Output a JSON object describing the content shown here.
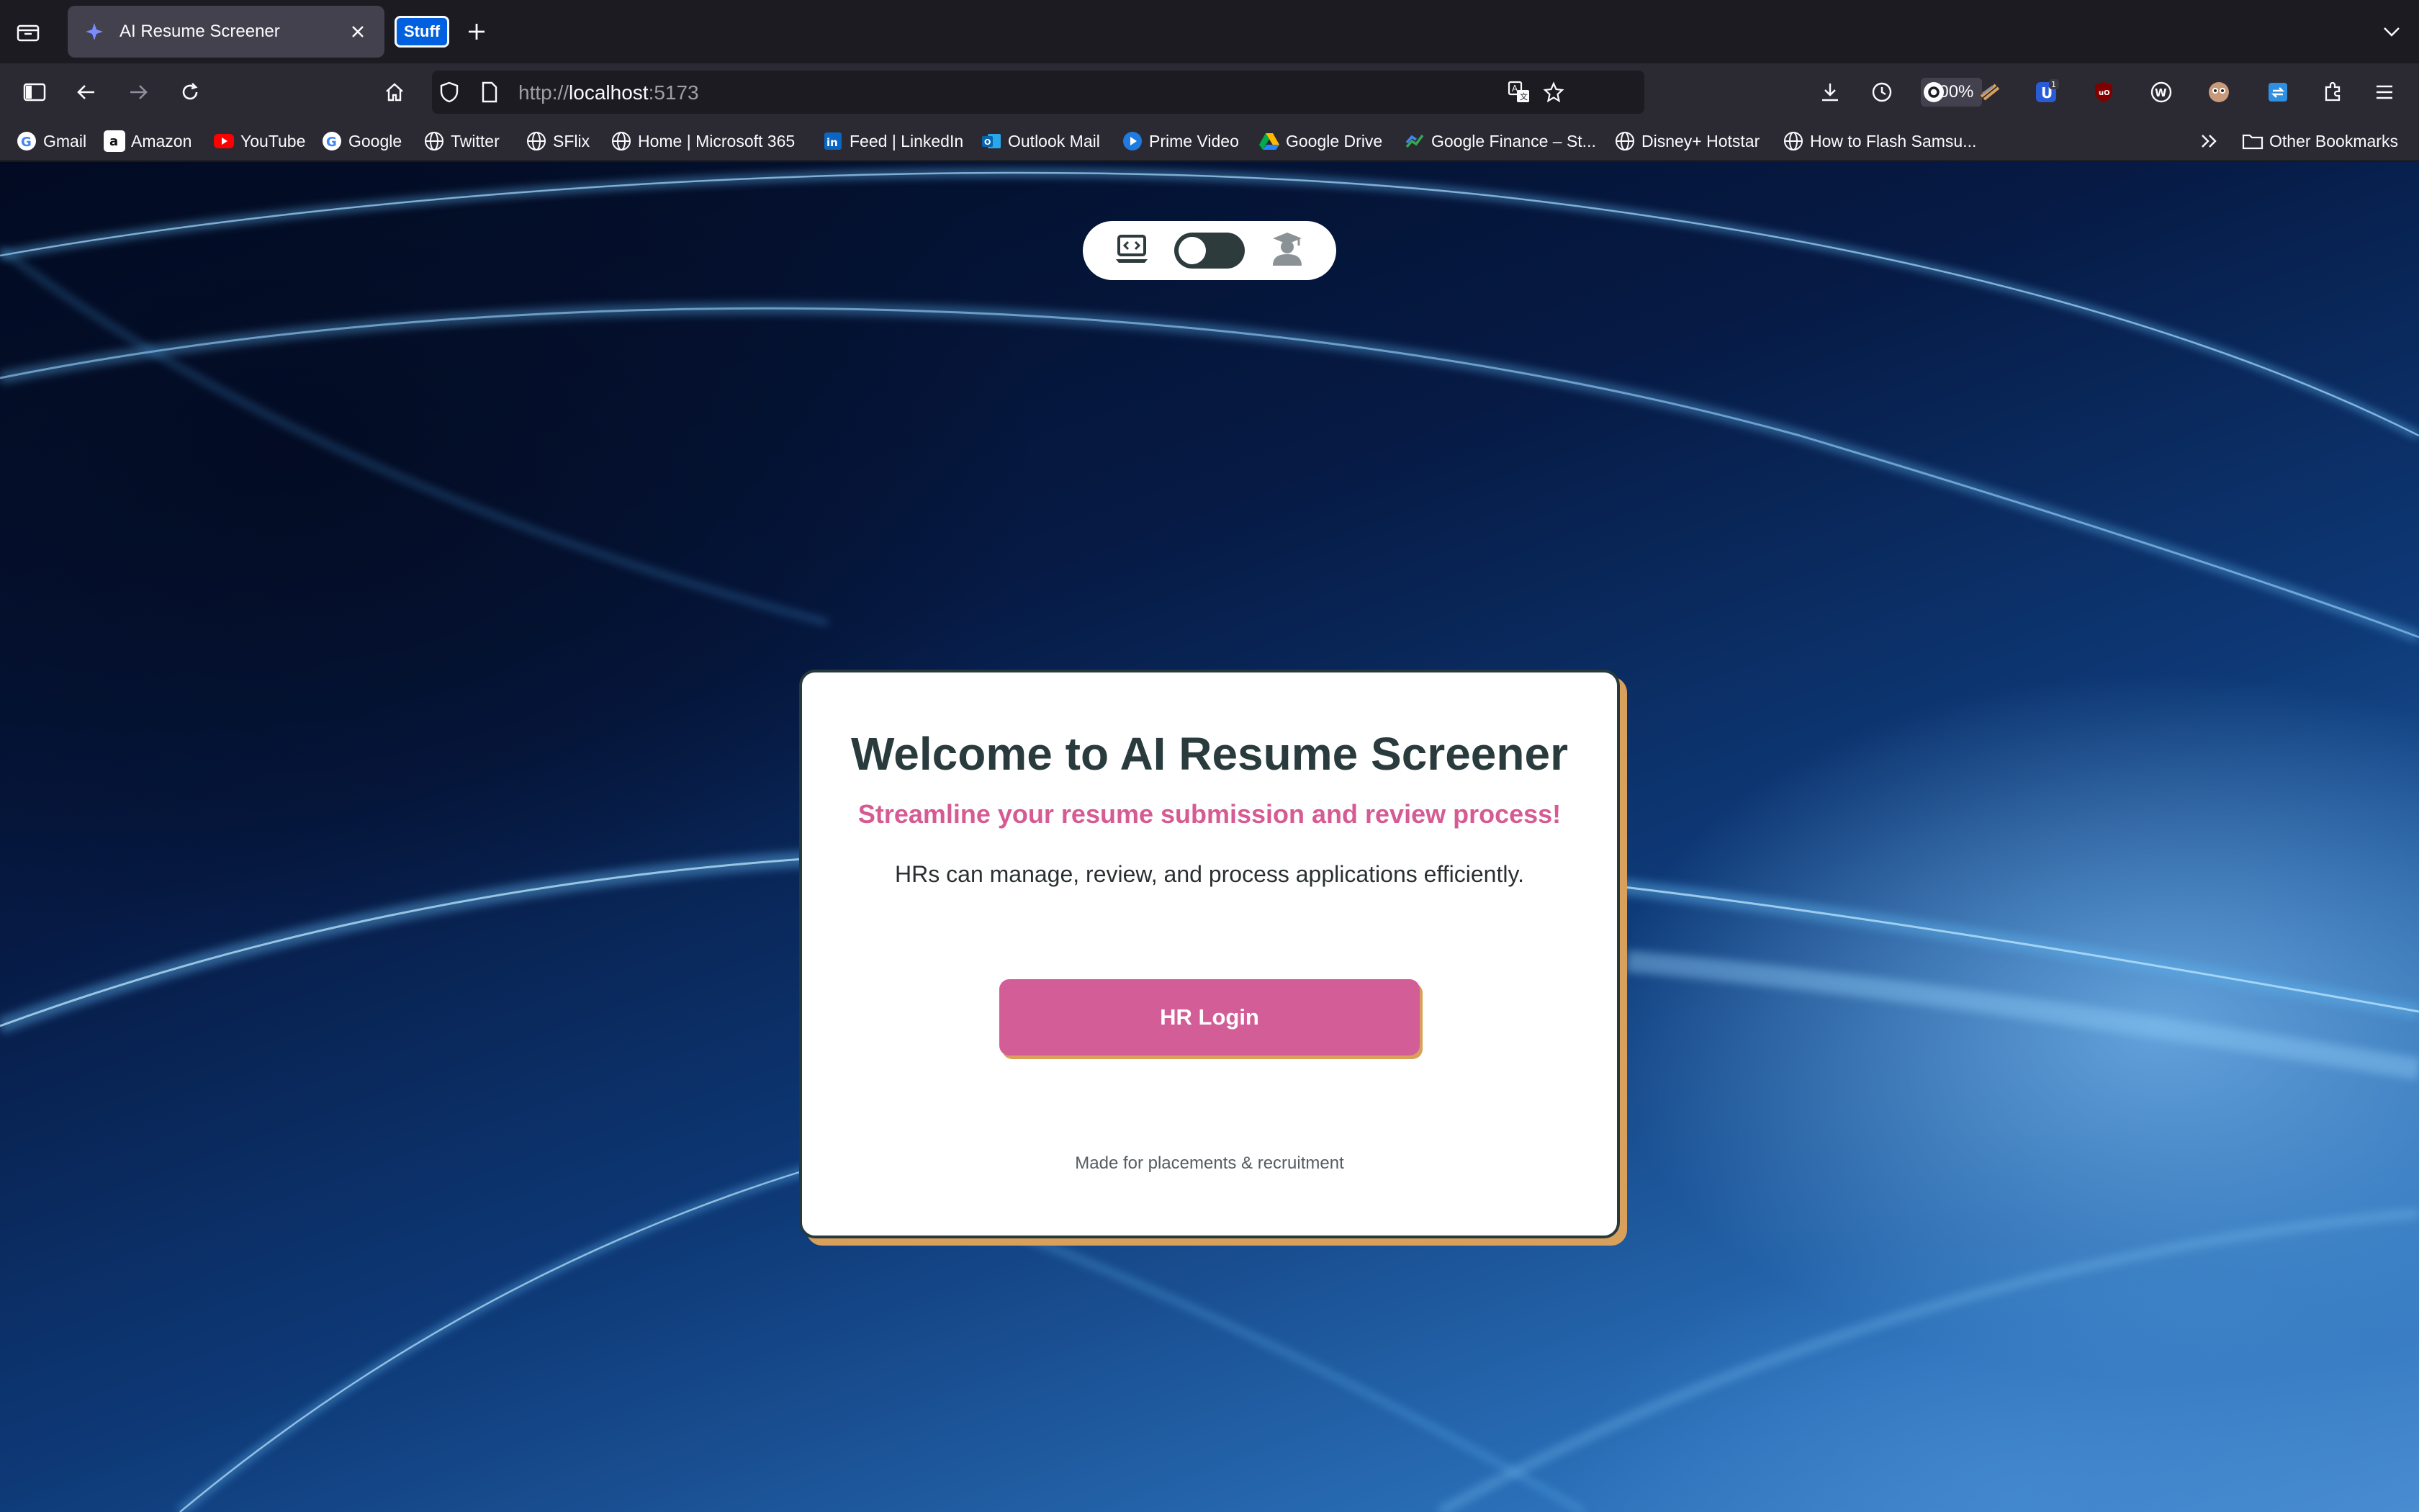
{
  "browser": {
    "tab": {
      "title": "AI Resume Screener",
      "favicon": "sparkle-icon"
    },
    "tab_group_label": "Stuff",
    "url": {
      "scheme": "http://",
      "host": "localhost",
      "port": ":5173"
    },
    "zoom": "100%",
    "bookmarks": [
      {
        "label": "Gmail",
        "icon": "google-g-icon"
      },
      {
        "label": "Amazon",
        "icon": "amazon-icon"
      },
      {
        "label": "YouTube",
        "icon": "youtube-icon"
      },
      {
        "label": "Google",
        "icon": "google-g-icon"
      },
      {
        "label": "Twitter",
        "icon": "globe-icon"
      },
      {
        "label": "SFlix",
        "icon": "globe-icon"
      },
      {
        "label": "Home | Microsoft 365",
        "icon": "globe-icon"
      },
      {
        "label": "Feed | LinkedIn",
        "icon": "linkedin-icon"
      },
      {
        "label": "Outlook Mail",
        "icon": "outlook-icon"
      },
      {
        "label": "Prime Video",
        "icon": "prime-video-icon"
      },
      {
        "label": "Google Drive",
        "icon": "google-drive-icon"
      },
      {
        "label": "Google Finance – St...",
        "icon": "google-finance-icon"
      },
      {
        "label": "Disney+ Hotstar",
        "icon": "globe-icon"
      },
      {
        "label": "How to Flash Samsu...",
        "icon": "globe-icon"
      }
    ],
    "other_bookmarks": "Other Bookmarks",
    "extension_badge": "1"
  },
  "page": {
    "mode_toggle": {
      "left_icon": "laptop-code-icon",
      "right_icon": "graduate-user-icon",
      "state": "off"
    },
    "card": {
      "title": "Welcome to AI Resume Screener",
      "subtitle": "Streamline your resume submission and review process!",
      "description": "HRs can manage, review, and process applications efficiently.",
      "login_button": "HR Login",
      "footer": "Made for placements & recruitment"
    }
  },
  "colors": {
    "accent_pink": "#d35e97",
    "shadow_gold": "#d9a05b",
    "title_dark": "#2a3b3d"
  }
}
